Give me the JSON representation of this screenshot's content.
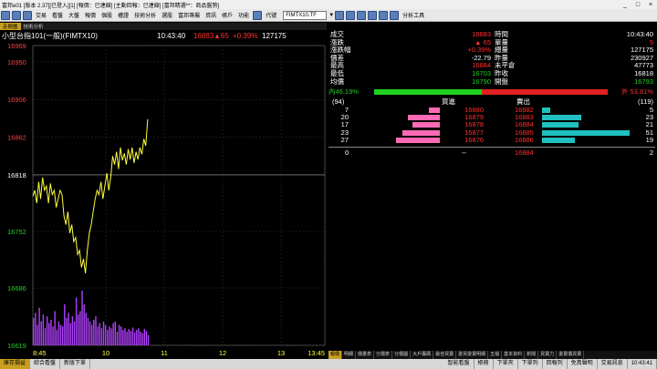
{
  "window": {
    "title": "富邦e01 [版本 2.37][已登入][1] [報價：已連線] [主動回報：已連線] [富邦精選**：商品盤勢]",
    "min": "_",
    "max": "□",
    "close": "×"
  },
  "menu": {
    "items": [
      "交易",
      "看盤",
      "大盤",
      "報價",
      "個股",
      "權證",
      "技術分析",
      "選股",
      "富邦專屬",
      "資訊",
      "帳戶",
      "功能"
    ],
    "symbol_prefix": "代號",
    "symbol": "FIMTX10.TF",
    "tools_label": "分析工具"
  },
  "tabs": [
    "走勢圖",
    "技術分析"
  ],
  "chart_header": {
    "name": "小型台指101(一般)(FIMTX10)",
    "time": "10:43:40",
    "price": "16883",
    "change": "▲65",
    "pct": "+0.39%",
    "volume": "127175"
  },
  "quote": {
    "rows": [
      {
        "l1": "成交",
        "v1": "16883",
        "c1": "red",
        "l2": "時間",
        "v2": "10:43:40",
        "c2": "wht"
      },
      {
        "l1": "漲跌",
        "v1": "▲ 65",
        "c1": "red",
        "l2": "單量",
        "v2": "5",
        "c2": "red"
      },
      {
        "l1": "漲跌幅",
        "v1": "+0.39%",
        "c1": "red",
        "l2": "總量",
        "v2": "127175",
        "c2": "wht"
      },
      {
        "l1": "價差",
        "v1": "-22.79",
        "c1": "wht",
        "l2": "昨量",
        "v2": "230927",
        "c2": "wht"
      },
      {
        "l1": "最高",
        "v1": "16884",
        "c1": "red",
        "l2": "未平倉",
        "v2": "47773",
        "c2": "wht"
      },
      {
        "l1": "最低",
        "v1": "16703",
        "c1": "grn",
        "l2": "昨收",
        "v2": "16818",
        "c2": "wht"
      },
      {
        "l1": "均價",
        "v1": "16790",
        "c1": "grn",
        "l2": "開盤",
        "v2": "16793",
        "c2": "grn"
      }
    ],
    "inner_label": "內",
    "inner_pct": "46.19%",
    "inner_ratio": 0.4619,
    "outer_label": "外",
    "outer_pct": "53.81%",
    "book_left_count": "(94)",
    "book_right_count": "(119)",
    "bid_header": "買進",
    "ask_header": "賣出",
    "book": [
      {
        "bq": "7",
        "bid": "16880",
        "ask": "16882",
        "aq": "5"
      },
      {
        "bq": "20",
        "bid": "16879",
        "ask": "16883",
        "aq": "23"
      },
      {
        "bq": "17",
        "bid": "16878",
        "ask": "16884",
        "aq": "21"
      },
      {
        "bq": "23",
        "bid": "16877",
        "ask": "16885",
        "aq": "51"
      },
      {
        "bq": "27",
        "bid": "16876",
        "ask": "16886",
        "aq": "19"
      }
    ],
    "total": {
      "bq": "0",
      "bid": "--",
      "ask": "16884",
      "aq": "2"
    }
  },
  "bottom_tabs": [
    "報價",
    "明細",
    "價量表",
    "分價表",
    "分價圖",
    "大戶籌碼",
    "最佳買賣",
    "委買委賣明細",
    "五檔",
    "基本資料",
    "新聞",
    "買賣力",
    "委賣價買賣"
  ],
  "status": {
    "items": [
      "庫存損益",
      "綜合看盤",
      "新版下單"
    ],
    "right_items": [
      "智能看盤",
      "帳務",
      "下單夾",
      "下單列",
      "回報列",
      "免責聲明",
      "交易訊息"
    ],
    "clock": "10:43:41"
  },
  "colors": {
    "up": "#ff3030",
    "down": "#20d020",
    "price_line": "#ffff40",
    "volume": "#b040ff",
    "axis": "#ff4040"
  },
  "chart_data": {
    "type": "line",
    "title": "小型台指101(一般)(FIMTX10)",
    "x_ticks": [
      "8:45",
      "10",
      "11",
      "12",
      "13",
      "13:45"
    ],
    "y_ticks": [
      16969,
      16950,
      16906,
      16862,
      16818,
      16752,
      16686,
      16619
    ],
    "ylim": [
      16619,
      16969
    ],
    "reference_price": 16818,
    "x_range_minutes": [
      0,
      300
    ],
    "series": [
      {
        "name": "price",
        "x": [
          0,
          2,
          4,
          6,
          8,
          10,
          12,
          14,
          16,
          18,
          20,
          22,
          24,
          26,
          28,
          30,
          32,
          34,
          36,
          38,
          40,
          42,
          44,
          46,
          48,
          50,
          52,
          54,
          56,
          58,
          60,
          62,
          64,
          66,
          68,
          70,
          72,
          74,
          76,
          78,
          80,
          82,
          84,
          86,
          88,
          90,
          92,
          94,
          96,
          98,
          100,
          102,
          104,
          106,
          108,
          110,
          112,
          114,
          116,
          118
        ],
        "values": [
          16793,
          16800,
          16785,
          16810,
          16790,
          16815,
          16800,
          16805,
          16785,
          16808,
          16795,
          16800,
          16780,
          16790,
          16800,
          16795,
          16770,
          16760,
          16775,
          16750,
          16760,
          16740,
          16745,
          16725,
          16730,
          16710,
          16720,
          16703,
          16730,
          16750,
          16760,
          16775,
          16790,
          16800,
          16795,
          16810,
          16790,
          16805,
          16820,
          16800,
          16815,
          16840,
          16830,
          16845,
          16825,
          16850,
          16835,
          16843,
          16830,
          16848,
          16836,
          16850,
          16832,
          16845,
          16836,
          16850,
          16842,
          16860,
          16852,
          16883
        ]
      }
    ],
    "volume": [
      80,
      95,
      60,
      110,
      70,
      90,
      50,
      85,
      65,
      75,
      55,
      100,
      45,
      70,
      60,
      55,
      120,
      80,
      95,
      65,
      85,
      70,
      140,
      90,
      100,
      160,
      120,
      95,
      80,
      70,
      60,
      75,
      85,
      55,
      65,
      50,
      70,
      60,
      45,
      55,
      50,
      65,
      70,
      40,
      60,
      55,
      45,
      50,
      40,
      48,
      42,
      52,
      38,
      45,
      50,
      40,
      35,
      48,
      42,
      30
    ]
  }
}
